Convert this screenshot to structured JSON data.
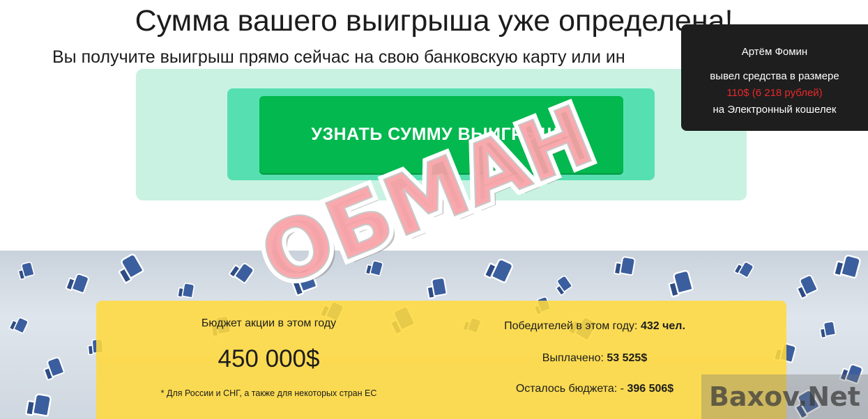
{
  "header": {
    "headline": "Сумма вашего выигрыша уже определена!",
    "subline": "Вы получите выигрыш прямо сейчас на свою банковскую карту или ин"
  },
  "cta": {
    "button_label": "УЗНАТЬ СУММУ ВЫИГРЫША"
  },
  "notification": {
    "name": "Артём Фомин",
    "line1": "вывел средства в размере",
    "amount": "110$ (6 218 рублей)",
    "line3": "на Электронный кошелек"
  },
  "stats": {
    "budget_title": "Бюджет акции в этом году",
    "budget_value": "450 000$",
    "budget_note": "* Для России и СНГ, а также для некоторых стран ЕС",
    "winners_label": "Победителей в этом году:",
    "winners_value": "432 чел.",
    "paid_label": "Выплачено:",
    "paid_value": "53 525$",
    "remaining_label": "Осталось бюджета: -",
    "remaining_value": "396 506$"
  },
  "overlay": {
    "stamp_text": "ОБМАН",
    "watermark": "Baxov.Net"
  },
  "colors": {
    "cta_green": "#02b84f",
    "stats_yellow": "#ffda3d",
    "notify_bg": "#1e1e1e",
    "notify_amount": "#e8282b",
    "stamp_red": "#f0323c"
  },
  "icons": [
    "like-thumb-icon"
  ]
}
